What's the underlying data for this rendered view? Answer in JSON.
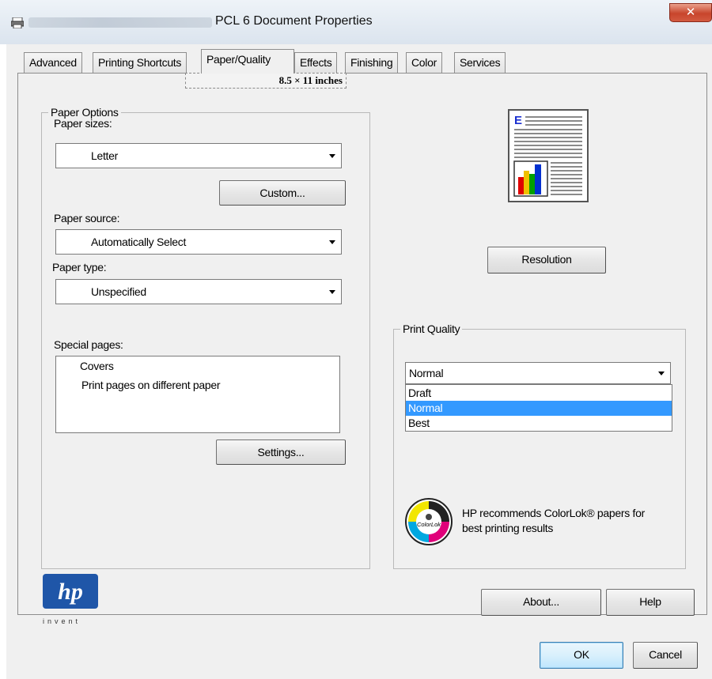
{
  "window": {
    "title": "PCL 6 Document Properties",
    "close_glyph": "✕"
  },
  "tabs": [
    {
      "label": "Advanced"
    },
    {
      "label": "Printing Shortcuts"
    },
    {
      "label": "Paper/Quality"
    },
    {
      "label": "Effects"
    },
    {
      "label": "Finishing"
    },
    {
      "label": "Color"
    },
    {
      "label": "Services"
    }
  ],
  "active_tab": "Paper/Quality",
  "paper_options": {
    "legend": "Paper Options",
    "paper_sizes_label": "Paper sizes:",
    "size_display": "8.5 × 11 inches",
    "paper_size_value": "Letter",
    "custom_button": "Custom...",
    "paper_source_label": "Paper source:",
    "paper_source_value": "Automatically Select",
    "paper_type_label": "Paper type:",
    "paper_type_value": "Unspecified",
    "special_pages_label": "Special pages:",
    "special_pages_items": [
      "Covers",
      "Print pages on different paper"
    ],
    "settings_button": "Settings..."
  },
  "resolution_button": "Resolution",
  "print_quality": {
    "legend": "Print Quality",
    "selected": "Normal",
    "options": [
      "Draft",
      "Normal",
      "Best"
    ],
    "highlighted_index": 1
  },
  "colorlok": {
    "logo_text": "ColorLok",
    "message_line1": "HP recommends ColorLok® papers for",
    "message_line2": "best printing results"
  },
  "hp_logo": {
    "mark": "hp",
    "tagline": "invent"
  },
  "buttons": {
    "about": "About...",
    "help": "Help",
    "ok": "OK",
    "cancel": "Cancel"
  },
  "preview": {
    "letter": "E",
    "bar_colors": [
      "#e00000",
      "#f0c000",
      "#00a000",
      "#0030d0"
    ]
  },
  "colors": {
    "highlight": "#3399ff",
    "hp_blue": "#1f56a8",
    "close_red": "#c8452c"
  }
}
